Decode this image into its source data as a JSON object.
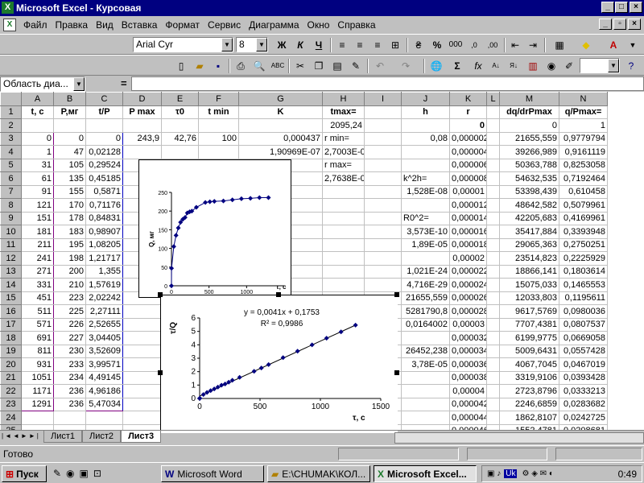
{
  "window": {
    "title": "Microsoft Excel - Курсовая",
    "app_icon": "excel-icon"
  },
  "menu": [
    "Файл",
    "Правка",
    "Вид",
    "Вставка",
    "Формат",
    "Сервис",
    "Диаграмма",
    "Окно",
    "Справка"
  ],
  "format_toolbar": {
    "font": "Arial Cyr",
    "size": "8",
    "bold": "Ж",
    "italic": "К",
    "underline": "Ч",
    "percent": "%",
    "thousands": "000"
  },
  "std_toolbar": {
    "sigma": "Σ",
    "fx": "fx",
    "zoom": ""
  },
  "formula_bar": {
    "name_box": "Область диа...",
    "equals": "=",
    "value": ""
  },
  "columns": [
    "A",
    "B",
    "C",
    "D",
    "E",
    "F",
    "G",
    "H",
    "I",
    "J",
    "K",
    "L",
    "M",
    "N"
  ],
  "rows": [
    [
      "1",
      "t, c",
      "P,мг",
      "t/P",
      "P max",
      "τ0",
      "t min",
      "K",
      "tmax=",
      "",
      "h",
      "r",
      "",
      "dq/drPmax",
      "q/Pmax="
    ],
    [
      "2",
      "",
      "",
      "",
      "",
      "",
      "",
      "",
      "2095,24",
      "",
      "",
      "0",
      "",
      "0",
      "1"
    ],
    [
      "3",
      "0",
      "0",
      "0",
      "243,9",
      "42,76",
      "100",
      "0,000437",
      "r min=",
      "",
      "0,08",
      "0,000002",
      "",
      "21655,559",
      "0,9779794"
    ],
    [
      "4",
      "1",
      "47",
      "0,02128",
      "",
      "",
      "",
      "1,90969E-07",
      "2,7003E-06",
      "",
      "",
      "0,000004",
      "",
      "39266,989",
      "0,9161119"
    ],
    [
      "5",
      "31",
      "105",
      "0,29524",
      "",
      "",
      "",
      "",
      "r max=",
      "",
      "",
      "0,000006",
      "",
      "50363,788",
      "0,8253058"
    ],
    [
      "6",
      "61",
      "135",
      "0,45185",
      "",
      "",
      "",
      "",
      "2,7638E-05",
      "",
      "k^2h=",
      "0,000008",
      "",
      "54632,535",
      "0,7192464"
    ],
    [
      "7",
      "91",
      "155",
      "0,5871",
      "",
      "",
      "",
      "",
      "",
      "",
      "1,528E-08",
      "0,00001",
      "",
      "53398,439",
      "0,610458"
    ],
    [
      "8",
      "121",
      "170",
      "0,71176",
      "",
      "",
      "",
      "",
      "",
      "",
      "",
      "0,000012",
      "",
      "48642,582",
      "0,5079961"
    ],
    [
      "9",
      "151",
      "178",
      "0,84831",
      "",
      "",
      "",
      "",
      "",
      "",
      "R0^2=",
      "0,000014",
      "",
      "42205,683",
      "0,4169961"
    ],
    [
      "10",
      "181",
      "183",
      "0,98907",
      "",
      "",
      "",
      "",
      "",
      "",
      "3,573E-10",
      "0,000016",
      "",
      "35417,884",
      "0,3393948"
    ],
    [
      "11",
      "211",
      "195",
      "1,08205",
      "",
      "",
      "",
      "",
      "",
      "",
      "1,89E-05",
      "0,000018",
      "",
      "29065,363",
      "0,2750251"
    ],
    [
      "12",
      "241",
      "198",
      "1,21717",
      "",
      "",
      "",
      "",
      "",
      "",
      "",
      "0,00002",
      "",
      "23514,823",
      "0,2225929"
    ],
    [
      "13",
      "271",
      "200",
      "1,355",
      "",
      "",
      "",
      "",
      "",
      "",
      "1,021E-24",
      "0,000022",
      "",
      "18866,141",
      "0,1803614"
    ],
    [
      "14",
      "331",
      "210",
      "1,57619",
      "",
      "",
      "",
      "",
      "",
      "",
      "4,716E-29",
      "0,000024",
      "",
      "15075,033",
      "0,1465553"
    ],
    [
      "15",
      "451",
      "223",
      "2,02242",
      "",
      "",
      "",
      "",
      "",
      "",
      "21655,559",
      "0,000026",
      "",
      "12033,803",
      "0,1195611"
    ],
    [
      "16",
      "511",
      "225",
      "2,27111",
      "",
      "",
      "",
      "",
      "",
      "",
      "5281790,8",
      "0,000028",
      "",
      "9617,5769",
      "0,0980036"
    ],
    [
      "17",
      "571",
      "226",
      "2,52655",
      "",
      "",
      "",
      "",
      "",
      "",
      "0,0164002",
      "0,00003",
      "",
      "7707,4381",
      "0,0807537"
    ],
    [
      "18",
      "691",
      "227",
      "3,04405",
      "",
      "",
      "",
      "",
      "",
      "",
      "",
      "0,000032",
      "",
      "6199,9775",
      "0,0669058"
    ],
    [
      "19",
      "811",
      "230",
      "3,52609",
      "",
      "",
      "",
      "",
      "",
      "",
      "26452,238",
      "0,000034",
      "",
      "5009,6431",
      "0,0557428"
    ],
    [
      "20",
      "931",
      "233",
      "3,99571",
      "",
      "",
      "",
      "",
      "",
      "",
      "3,78E-05",
      "0,000036",
      "",
      "4067,7045",
      "0,0467019"
    ],
    [
      "21",
      "1051",
      "234",
      "4,49145",
      "",
      "",
      "",
      "",
      "",
      "",
      "",
      "0,000038",
      "",
      "3319,9106",
      "0,0393428"
    ],
    [
      "22",
      "1171",
      "236",
      "4,96186",
      "",
      "",
      "",
      "",
      "",
      "",
      "",
      "0,00004",
      "",
      "2723,8796",
      "0,0333213"
    ],
    [
      "23",
      "1291",
      "236",
      "5,47034",
      "",
      "",
      "",
      "",
      "",
      "",
      "",
      "0,000042",
      "",
      "2246,6859",
      "0,0283682"
    ],
    [
      "24",
      "",
      "",
      "",
      "",
      "",
      "",
      "",
      "",
      "",
      "",
      "0,000044",
      "",
      "1862,8107",
      "0,0242725"
    ],
    [
      "25",
      "",
      "",
      "",
      "",
      "",
      "",
      "",
      "",
      "",
      "",
      "0,000046",
      "",
      "1552,4781",
      "0,0208681"
    ],
    [
      "26",
      "",
      "",
      "",
      "",
      "",
      "",
      "",
      "",
      "",
      "",
      "0,000048",
      "",
      "1300,341",
      "0,0180238"
    ],
    [
      "27",
      "",
      "",
      "",
      "",
      "",
      "",
      "",
      "",
      "",
      "",
      "0,00005",
      "",
      "1094,459",
      "0,0156359"
    ]
  ],
  "sheet_tabs": [
    "Лист1",
    "Лист2",
    "Лист3"
  ],
  "status": "Готово",
  "taskbar": {
    "start": "Пуск",
    "items": [
      "Microsoft Word",
      "E:\\CHUMAK\\КОЛ...",
      "Microsoft Excel..."
    ],
    "clock": "0:49",
    "lang": "Uk"
  },
  "chart_data": [
    {
      "type": "scatter",
      "title": "",
      "xlabel": "τ, с",
      "ylabel": "Q, мг",
      "xlim": [
        0,
        1500
      ],
      "ylim": [
        0,
        250
      ],
      "xticks": [
        "0",
        "500",
        "1000"
      ],
      "yticks": [
        "0",
        "50",
        "100",
        "150",
        "200",
        "250"
      ],
      "x": [
        0,
        1,
        31,
        61,
        91,
        121,
        151,
        181,
        211,
        241,
        271,
        331,
        451,
        511,
        571,
        691,
        811,
        931,
        1051,
        1171,
        1291
      ],
      "y": [
        0,
        47,
        105,
        135,
        155,
        170,
        178,
        183,
        195,
        198,
        200,
        210,
        223,
        225,
        226,
        227,
        230,
        233,
        234,
        236,
        236
      ]
    },
    {
      "type": "scatter",
      "title": "",
      "xlabel": "τ, с",
      "ylabel": "τ/Q",
      "xlim": [
        0,
        1500
      ],
      "ylim": [
        0,
        6
      ],
      "xticks": [
        "0",
        "500",
        "1000",
        "1500"
      ],
      "yticks": [
        "0",
        "1",
        "2",
        "3",
        "4",
        "5",
        "6"
      ],
      "trendline": "y = 0,0041x + 0,1753",
      "r2": "R² = 0,9986",
      "x": [
        0,
        1,
        31,
        61,
        91,
        121,
        151,
        181,
        211,
        241,
        271,
        331,
        451,
        511,
        571,
        691,
        811,
        931,
        1051,
        1171,
        1291
      ],
      "y": [
        0,
        0.02128,
        0.29524,
        0.45185,
        0.5871,
        0.71176,
        0.84831,
        0.98907,
        1.08205,
        1.21717,
        1.355,
        1.57619,
        2.02242,
        2.27111,
        2.52655,
        3.04405,
        3.52609,
        3.99571,
        4.49145,
        4.96186,
        5.47034
      ]
    }
  ]
}
